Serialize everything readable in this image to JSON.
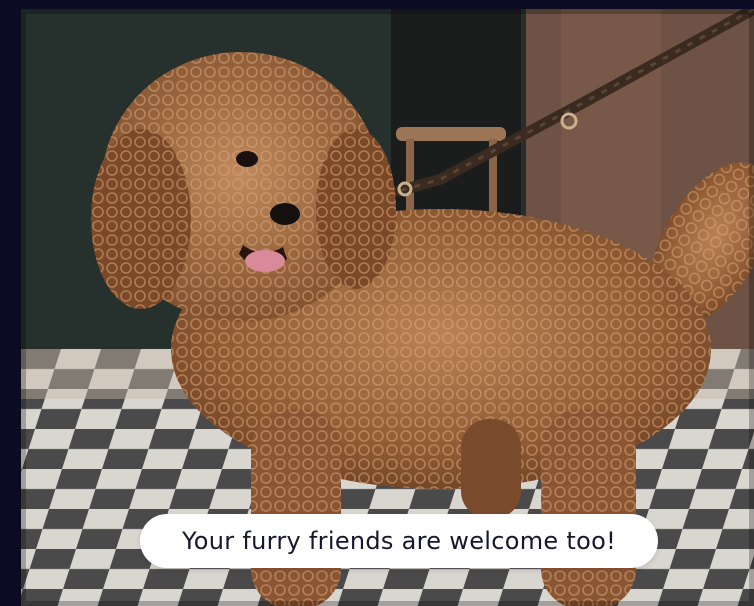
{
  "photo": {
    "subject_icon": "dog-photo",
    "caption": "Your furry friends are welcome too!"
  },
  "colors": {
    "frame_background": "#0b0c24",
    "pill_background": "#ffffff",
    "caption_text": "#16172e"
  }
}
